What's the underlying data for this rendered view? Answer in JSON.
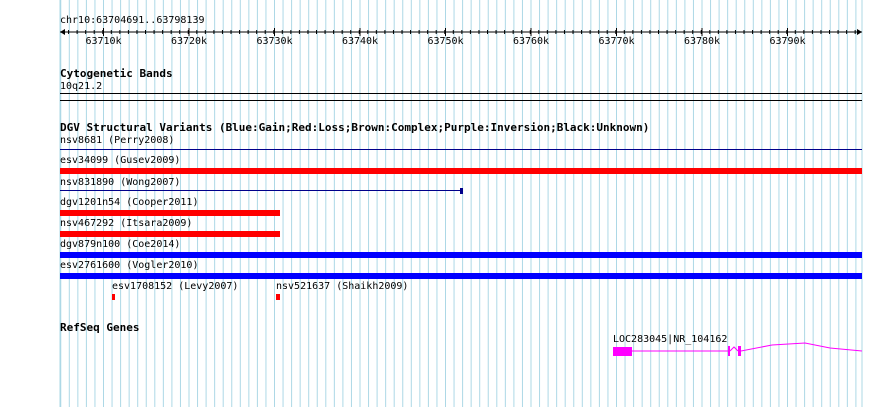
{
  "ruler": {
    "location": "chr10:63704691..63798139",
    "ticks": [
      "63710k",
      "63720k",
      "63730k",
      "63740k",
      "63750k",
      "63760k",
      "63770k",
      "63780k",
      "63790k"
    ]
  },
  "cytoband": {
    "title": "Cytogenetic Bands",
    "band": "10q21.2"
  },
  "dgv": {
    "title": "DGV Structural Variants (Blue:Gain;Red:Loss;Brown:Complex;Purple:Inversion;Black:Unknown)",
    "variants": [
      {
        "label": "nsv8681 (Perry2008)",
        "type": "unknown",
        "color": "#00008b"
      },
      {
        "label": "esv34099 (Gusev2009)",
        "type": "loss",
        "color": "#ff0000"
      },
      {
        "label": "nsv831890 (Wong2007)",
        "type": "gain",
        "color": "#00008b"
      },
      {
        "label": "dgv1201n54 (Cooper2011)",
        "type": "loss",
        "color": "#ff0000"
      },
      {
        "label": "nsv467292 (Itsara2009)",
        "type": "loss",
        "color": "#ff0000"
      },
      {
        "label": "dgv879n100 (Coe2014)",
        "type": "gain",
        "color": "#0000ff"
      },
      {
        "label": "esv2761600 (Vogler2010)",
        "type": "gain",
        "color": "#0000ff"
      },
      {
        "label": "esv1708152 (Levy2007)",
        "type": "loss",
        "color": "#ff0000"
      },
      {
        "label": "nsv521637 (Shaikh2009)",
        "type": "loss",
        "color": "#ff0000"
      }
    ]
  },
  "refseq": {
    "title": "RefSeq Genes",
    "gene_label": "LOC283045|NR_104162",
    "gene_color": "#ff00ff"
  },
  "colors": {
    "gridline": "#add8e6",
    "loss": "#ff0000",
    "gain": "#0000ff"
  }
}
